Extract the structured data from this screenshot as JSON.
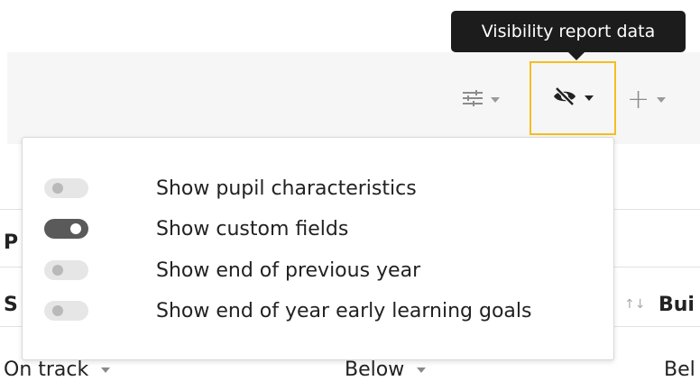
{
  "tooltip": {
    "text": "Visibility report data"
  },
  "toolbar": {
    "filter_icon": "sliders-icon",
    "visibility_icon": "eye-slash-icon",
    "add_icon": "plus-icon",
    "highlight_color": "#f5be1e"
  },
  "background": {
    "header_p": "P",
    "header_s": "S",
    "header_bui": "Bui",
    "sort_glyph": "↑↓",
    "row1": {
      "col1": "On track",
      "col2": "Below",
      "col3": "Bel"
    }
  },
  "dropdown": {
    "options": [
      {
        "label": "Show pupil characteristics",
        "enabled": false
      },
      {
        "label": "Show custom fields",
        "enabled": true
      },
      {
        "label": "Show end of previous year",
        "enabled": false
      },
      {
        "label": "Show end of year early learning goals",
        "enabled": false
      }
    ]
  }
}
